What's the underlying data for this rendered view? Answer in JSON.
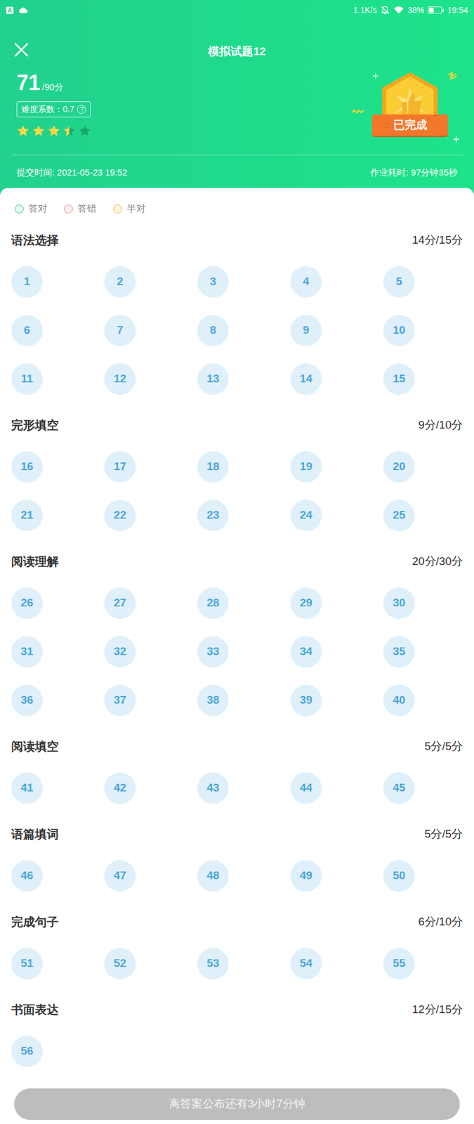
{
  "status_bar": {
    "network_speed": "1.1K/s",
    "battery": "38%",
    "battery_level": 0.38,
    "time": "19:54"
  },
  "header": {
    "title": "模拟试题12",
    "score": "71",
    "total": "/90分",
    "difficulty": "难度系数：0.7",
    "help": "?",
    "stars": 3.5,
    "badge": "已完成",
    "submit_time": "提交时间: 2021-05-23 19:52",
    "duration": "作业耗时: 97分钟35秒"
  },
  "legend": [
    {
      "label": "答对",
      "color": "#3cc98b"
    },
    {
      "label": "答错",
      "color": "#f08a9a"
    },
    {
      "label": "半对",
      "color": "#f3b43f"
    }
  ],
  "sections": [
    {
      "title": "语法选择",
      "score": "14分/15分",
      "questions": [
        "1",
        "2",
        "3",
        "4",
        "5",
        "6",
        "7",
        "8",
        "9",
        "10",
        "11",
        "12",
        "13",
        "14",
        "15"
      ]
    },
    {
      "title": "完形填空",
      "score": "9分/10分",
      "questions": [
        "16",
        "17",
        "18",
        "19",
        "20",
        "21",
        "22",
        "23",
        "24",
        "25"
      ]
    },
    {
      "title": "阅读理解",
      "score": "20分/30分",
      "questions": [
        "26",
        "27",
        "28",
        "29",
        "30",
        "31",
        "32",
        "33",
        "34",
        "35",
        "36",
        "37",
        "38",
        "39",
        "40"
      ]
    },
    {
      "title": "阅读填空",
      "score": "5分/5分",
      "questions": [
        "41",
        "42",
        "43",
        "44",
        "45"
      ]
    },
    {
      "title": "语篇填词",
      "score": "5分/5分",
      "questions": [
        "46",
        "47",
        "48",
        "49",
        "50"
      ]
    },
    {
      "title": "完成句子",
      "score": "6分/10分",
      "questions": [
        "51",
        "52",
        "53",
        "54",
        "55"
      ]
    },
    {
      "title": "书面表达",
      "score": "12分/15分",
      "questions": [
        "56"
      ]
    }
  ],
  "footer_button": {
    "label": "离答案公布还有3小时7分钟",
    "disabled": true
  }
}
